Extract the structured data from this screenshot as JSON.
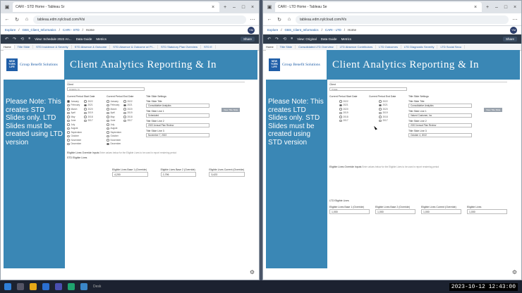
{
  "left": {
    "tab_title": "CARI - STD Home - Tableau Sr",
    "url": "tableau.edm.nylcloud.com/#/si",
    "avatar": "YM",
    "crumbs": [
      "Explore",
      "GBS_Client_Informatics",
      "CARI - STD",
      "Home"
    ],
    "toolbar": {
      "view": "View: Schedule 2022 An...",
      "data_guide": "Data Guide",
      "metrics": "Metrics",
      "share": "Share"
    },
    "sheets": [
      "Home",
      "Title Slide",
      "STD Incidence & Severity",
      "STD Absence & Outcome",
      "STD Absence & Outcome w/ Pl...",
      "STD Statutory Plan Overview",
      "STD E"
    ],
    "banner_title": "Client Analytics Reporting & In",
    "logo_box": "NEW YORK LIFE",
    "logo_text": "Group Benefit Solutions",
    "note": "Please Note: This creates STD Slides only. LTD Slides must be created using LTD version",
    "client_label": "Client",
    "client_value": "Amwins, In",
    "start_label": "Current Period Start Date",
    "end_label": "Current Period End Date",
    "title_settings": "Title Slide Settings",
    "view_title": "View Title Slide",
    "months": [
      "January",
      "February",
      "March",
      "April",
      "May",
      "June",
      "July",
      "August",
      "September",
      "October",
      "November",
      "December"
    ],
    "years": [
      "2022",
      "2021",
      "2020",
      "2019",
      "2018",
      "2017"
    ],
    "title_label": "Title Slide Title",
    "title_value": "Consolidative Analytics",
    "line1_label": "Title Slide Line 1",
    "line1_value": "Scheduled",
    "line2_label": "Title Slide Line 2",
    "line2_value": "2022 Annual Plan Review",
    "line3_label": "Title Slide Line 3",
    "line3_value": "November 7, 2022",
    "eligible_label": "Eligible Lives Override Inputs",
    "eligible_hint": "Enter values below for the Eligible Lives to be used in report rendering period",
    "std_label": "STD Eligible Lives",
    "inputs": [
      {
        "label": "Eligible Lives Base 1 (Override)",
        "value": "4,200"
      },
      {
        "label": "Eligible Lives Base 2 (Override)",
        "value": "2,796"
      },
      {
        "label": "Eligible Lives Current (Override)",
        "value": "3,423"
      }
    ]
  },
  "right": {
    "tab_title": "CARI - LTD Home - Tableau Se",
    "url": "tableau.edm.nylcloud.com/#/s",
    "avatar": "YM",
    "crumbs": [
      "Explore",
      "GBS_Client_Informatics",
      "CARI - LTD",
      "Home"
    ],
    "toolbar": {
      "view": "View: Original",
      "data_guide": "Data Guide",
      "metrics": "Metrics",
      "share": "Share"
    },
    "sheets": [
      "Home",
      "Title Slide",
      "Consolidated LTD Overview",
      "LTD Absence Contributors",
      "LTD Outcomes",
      "LTD Diagnostic Severity",
      "LTD Social Secu"
    ],
    "banner_title": "Client Analytics Reporting & In",
    "logo_box": "NEW YORK LIFE",
    "logo_text": "Group Benefit Solutions",
    "note": "Please Note: This creates LTD Slides only. STD Slides must be created using STD version",
    "client_label": "Client",
    "client_value": "Vmwa",
    "start_label": "Current Period Start Date",
    "end_label": "Current Period End Date",
    "title_settings": "Title Slide Settings",
    "view_title": "View Title Slide",
    "years": [
      "2022",
      "2021",
      "2020",
      "2019",
      "2018",
      "2017"
    ],
    "title_label": "Title Slide Title",
    "title_value": "Consolidative Analytics",
    "line1_label": "Title Slide Line 1",
    "line1_value": "Valued Customer, Inc",
    "line2_label": "Title Slide Line 2",
    "line2_value": "2022 Annual Plan Review",
    "line3_label": "Title Slide Line 3",
    "line3_value": "October 4, 2022",
    "eligible_label": "Eligible Lives Override Inputs",
    "eligible_hint": "Enter values below for the Eligible Lives to be used in report rendering period",
    "ltd_label": "LTD Eligible Lives",
    "inputs": [
      {
        "label": "Eligible Lives Base 1 (Override)",
        "value": "1,000"
      },
      {
        "label": "Eligible Lives Base 2 (Override)",
        "value": "1,000"
      },
      {
        "label": "Eligible Lives Current (Override)",
        "value": "1,000"
      },
      {
        "label": "Eligible Lives",
        "value": "1,000"
      }
    ]
  },
  "taskbar": {
    "clock": "2023-10-12 12:43:00",
    "desk": "Desk"
  }
}
